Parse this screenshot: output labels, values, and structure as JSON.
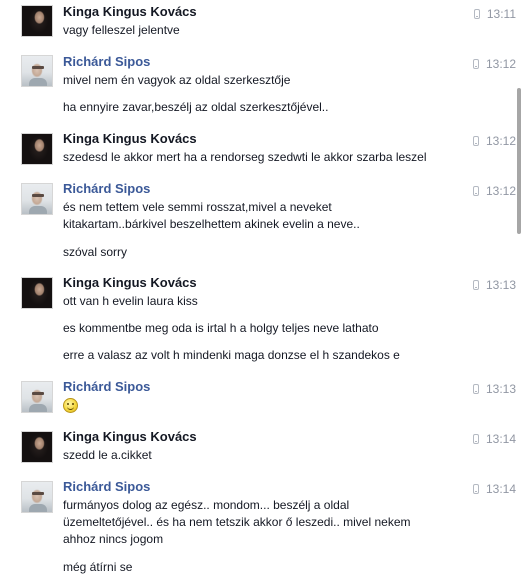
{
  "messages": [
    {
      "author": "Kinga Kingus Kovács",
      "time": "13:11",
      "lines": [
        "vagy felleszel jelentve"
      ]
    },
    {
      "author": "Richárd Sipos",
      "time": "13:12",
      "lines": [
        "mivel nem én vagyok az oldal szerkesztője",
        "ha ennyire zavar,beszélj az oldal szerkesztőjével.."
      ]
    },
    {
      "author": "Kinga Kingus Kovács",
      "time": "13:12",
      "lines": [
        "szedesd le akkor mert ha a rendorseg szedwti le akkor szarba leszel"
      ]
    },
    {
      "author": "Richárd Sipos",
      "time": "13:12",
      "lines": [
        "és nem tettem vele semmi rosszat,mivel a neveket",
        "kitakartam..bárkivel beszelhettem akinek evelin a neve..",
        "szóval sorry"
      ]
    },
    {
      "author": "Kinga Kingus Kovács",
      "time": "13:13",
      "lines": [
        "ott van h evelin laura kiss",
        "es kommentbe meg oda is irtal h a holgy teljes neve lathato",
        " erre a valasz az volt h mindenki maga donzse el h szandekos e"
      ]
    },
    {
      "author": "Richárd Sipos",
      "time": "13:13",
      "emoticon": "smiley"
    },
    {
      "author": "Kinga Kingus Kovács",
      "time": "13:14",
      "lines": [
        "szedd le a.cikket"
      ]
    },
    {
      "author": "Richárd Sipos",
      "time": "13:14",
      "lines": [
        "furmányos dolog az egész.. mondom... beszélj a oldal",
        "üzemeltetőjével.. és ha nem tetszik akkor ő leszedi.. mivel nekem",
        "ahhoz nincs jogom",
        "még átírni se"
      ]
    }
  ]
}
